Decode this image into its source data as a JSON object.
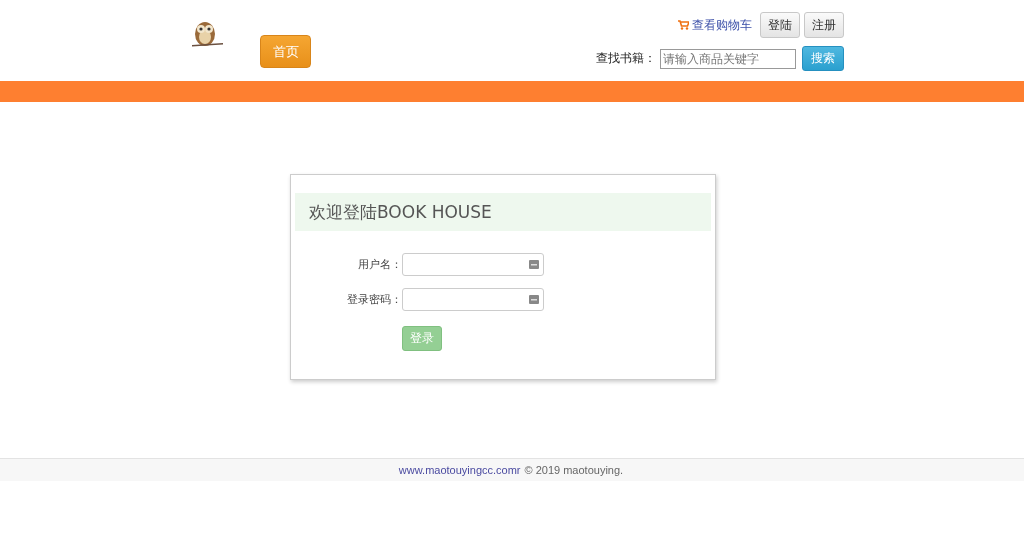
{
  "header": {
    "home_button": "首页",
    "cart_link": "查看购物车",
    "login_button": "登陆",
    "register_button": "注册",
    "search": {
      "label": "查找书籍：",
      "placeholder": "请输入商品关键字",
      "button": "搜索"
    }
  },
  "login": {
    "title": "欢迎登陆BOOK HOUSE",
    "fields": [
      {
        "label": "用户名："
      },
      {
        "label": "登录密码："
      }
    ],
    "submit": "登录"
  },
  "footer": {
    "link": "www.maotouyingcc.comr",
    "text": "© 2019 maotouying."
  }
}
